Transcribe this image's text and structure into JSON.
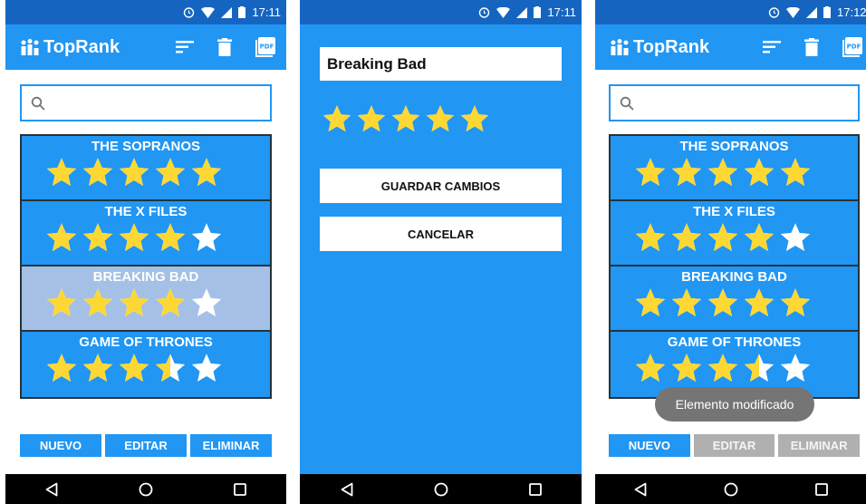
{
  "status": {
    "time_1": "17:11",
    "time_2": "17:11",
    "time_3": "17:12"
  },
  "app": {
    "title": "TopRank"
  },
  "icons": [
    "app-logo-icon",
    "sort-icon",
    "delete-icon",
    "pdf-icon",
    "search-icon",
    "star-icon",
    "back-icon",
    "home-icon",
    "recents-icon"
  ],
  "list_screen": {
    "items": [
      {
        "name": "THE SOPRANOS",
        "rating": 5
      },
      {
        "name": "THE X FILES",
        "rating": 4
      },
      {
        "name": "BREAKING BAD",
        "rating": 4
      },
      {
        "name": "GAME OF THRONES",
        "rating": 3.5
      }
    ],
    "buttons": {
      "new": "NUEVO",
      "edit": "EDITAR",
      "delete": "ELIMINAR"
    }
  },
  "edit_screen": {
    "name_value": "Breaking Bad",
    "rating": 5,
    "save_label": "GUARDAR CAMBIOS",
    "cancel_label": "CANCELAR"
  },
  "updated_screen": {
    "items": [
      {
        "name": "THE SOPRANOS",
        "rating": 5
      },
      {
        "name": "THE X FILES",
        "rating": 4
      },
      {
        "name": "BREAKING BAD",
        "rating": 5
      },
      {
        "name": "GAME OF THRONES",
        "rating": 3.5
      }
    ],
    "buttons": {
      "new": "NUEVO",
      "edit": "EDITAR",
      "delete": "ELIMINAR"
    },
    "toast": "Elemento modificado"
  },
  "colors": {
    "primary": "#2196f3",
    "status_bar": "#1565c0",
    "star_gold": "#fdd835",
    "selected_row": "#a5c0e6",
    "disabled": "#b0b0b0"
  }
}
